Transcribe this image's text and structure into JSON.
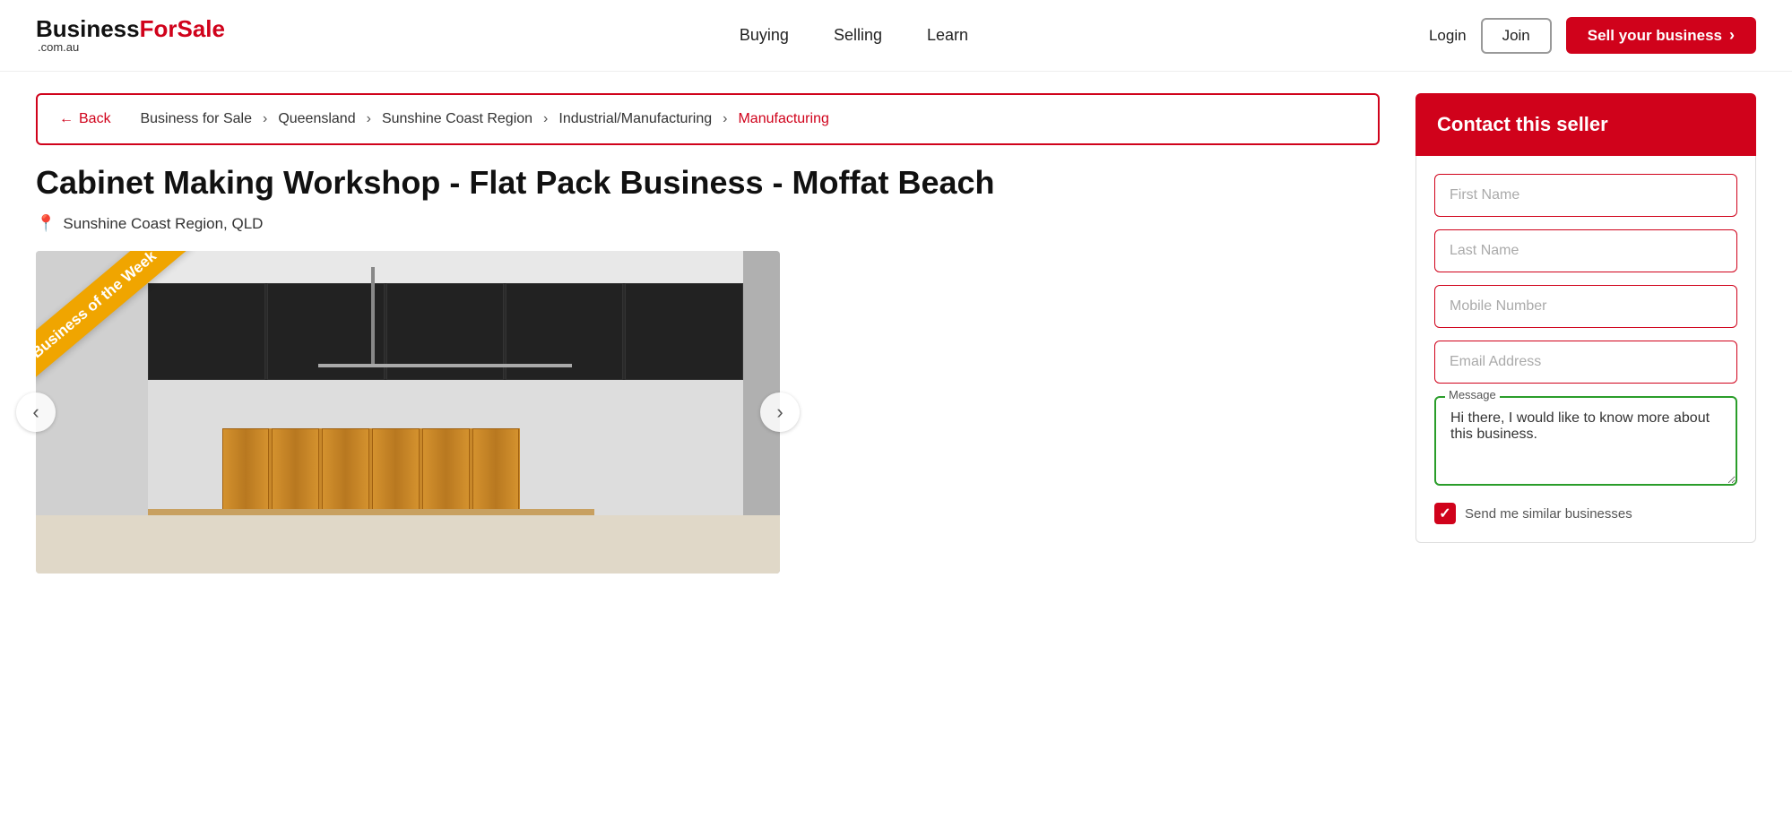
{
  "header": {
    "logo": {
      "business": "Business",
      "forsale": "ForSale",
      "domain": ".com.au"
    },
    "nav": [
      {
        "label": "Buying",
        "id": "buying"
      },
      {
        "label": "Selling",
        "id": "selling"
      },
      {
        "label": "Learn",
        "id": "learn"
      }
    ],
    "login_label": "Login",
    "join_label": "Join",
    "sell_label": "Sell your business",
    "sell_chevron": "›"
  },
  "breadcrumb": {
    "back_label": "Back",
    "back_arrow": "←",
    "items": [
      {
        "label": "Business for Sale",
        "active": false
      },
      {
        "label": "Queensland",
        "active": false
      },
      {
        "label": "Sunshine Coast Region",
        "active": false
      },
      {
        "label": "Industrial/Manufacturing",
        "active": false
      },
      {
        "label": "Manufacturing",
        "active": true
      }
    ],
    "separator": "›"
  },
  "listing": {
    "title": "Cabinet Making Workshop - Flat Pack Business - Moffat Beach",
    "location": "Sunshine Coast Region, QLD",
    "pin_icon": "📍",
    "ribbon_text": "Business of the Week",
    "arrow_left": "‹",
    "arrow_right": "›"
  },
  "contact_form": {
    "header_title": "Contact this seller",
    "first_name_placeholder": "First Name",
    "last_name_placeholder": "Last Name",
    "mobile_placeholder": "Mobile Number",
    "email_placeholder": "Email Address",
    "message_label": "Message",
    "message_value": "Hi there, I would like to know more about this business.",
    "similar_text": "Send me similar businesses"
  }
}
